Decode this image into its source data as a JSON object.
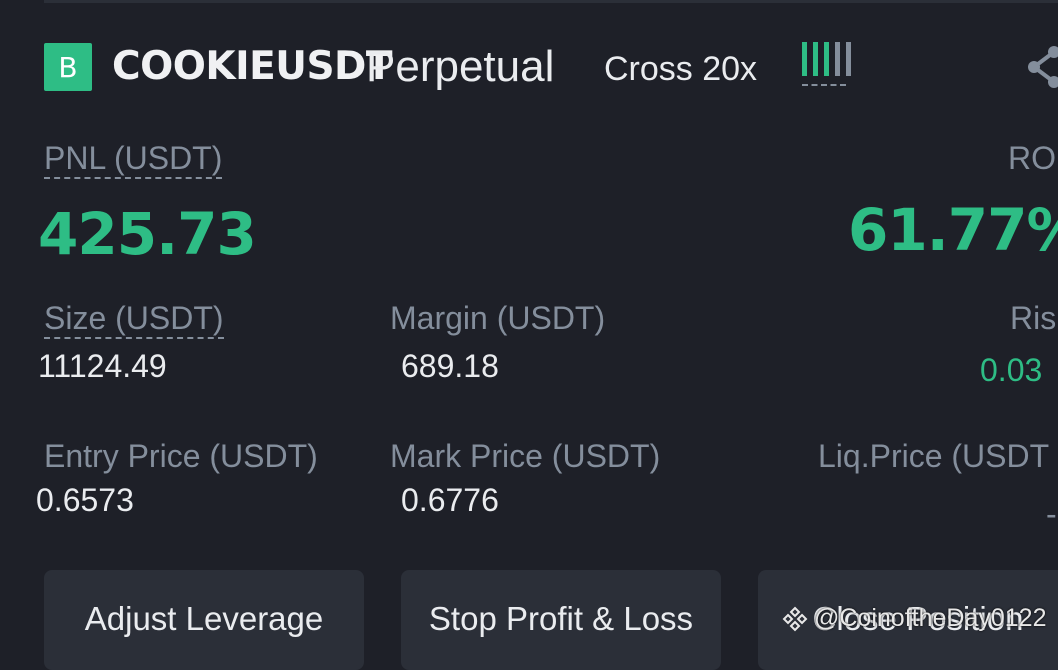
{
  "header": {
    "side_badge": "B",
    "symbol": "COOKIEUSDT",
    "product_type": "Perpetual",
    "margin_mode": "Cross 20x",
    "colors": {
      "accent_green": "#2ebd85",
      "muted": "#848e9c"
    }
  },
  "pnl": {
    "label": "PNL (USDT)",
    "value": "425.73"
  },
  "roi": {
    "label": "RO",
    "value": "61.77%"
  },
  "size": {
    "label": "Size (USDT)",
    "value": "11124.49"
  },
  "margin": {
    "label": "Margin (USDT)",
    "value": "689.18"
  },
  "risk": {
    "label": "Ris",
    "value": "0.03"
  },
  "entry_price": {
    "label": "Entry Price (USDT)",
    "value": "0.6573"
  },
  "mark_price": {
    "label": "Mark Price (USDT)",
    "value": "0.6776"
  },
  "liq_price": {
    "label": "Liq.Price (USDT",
    "value": "--"
  },
  "buttons": {
    "adjust_leverage": "Adjust Leverage",
    "stop_profit_loss": "Stop Profit & Loss",
    "close_position": "Close Position"
  },
  "watermark": "@CoinoftheDay0122"
}
